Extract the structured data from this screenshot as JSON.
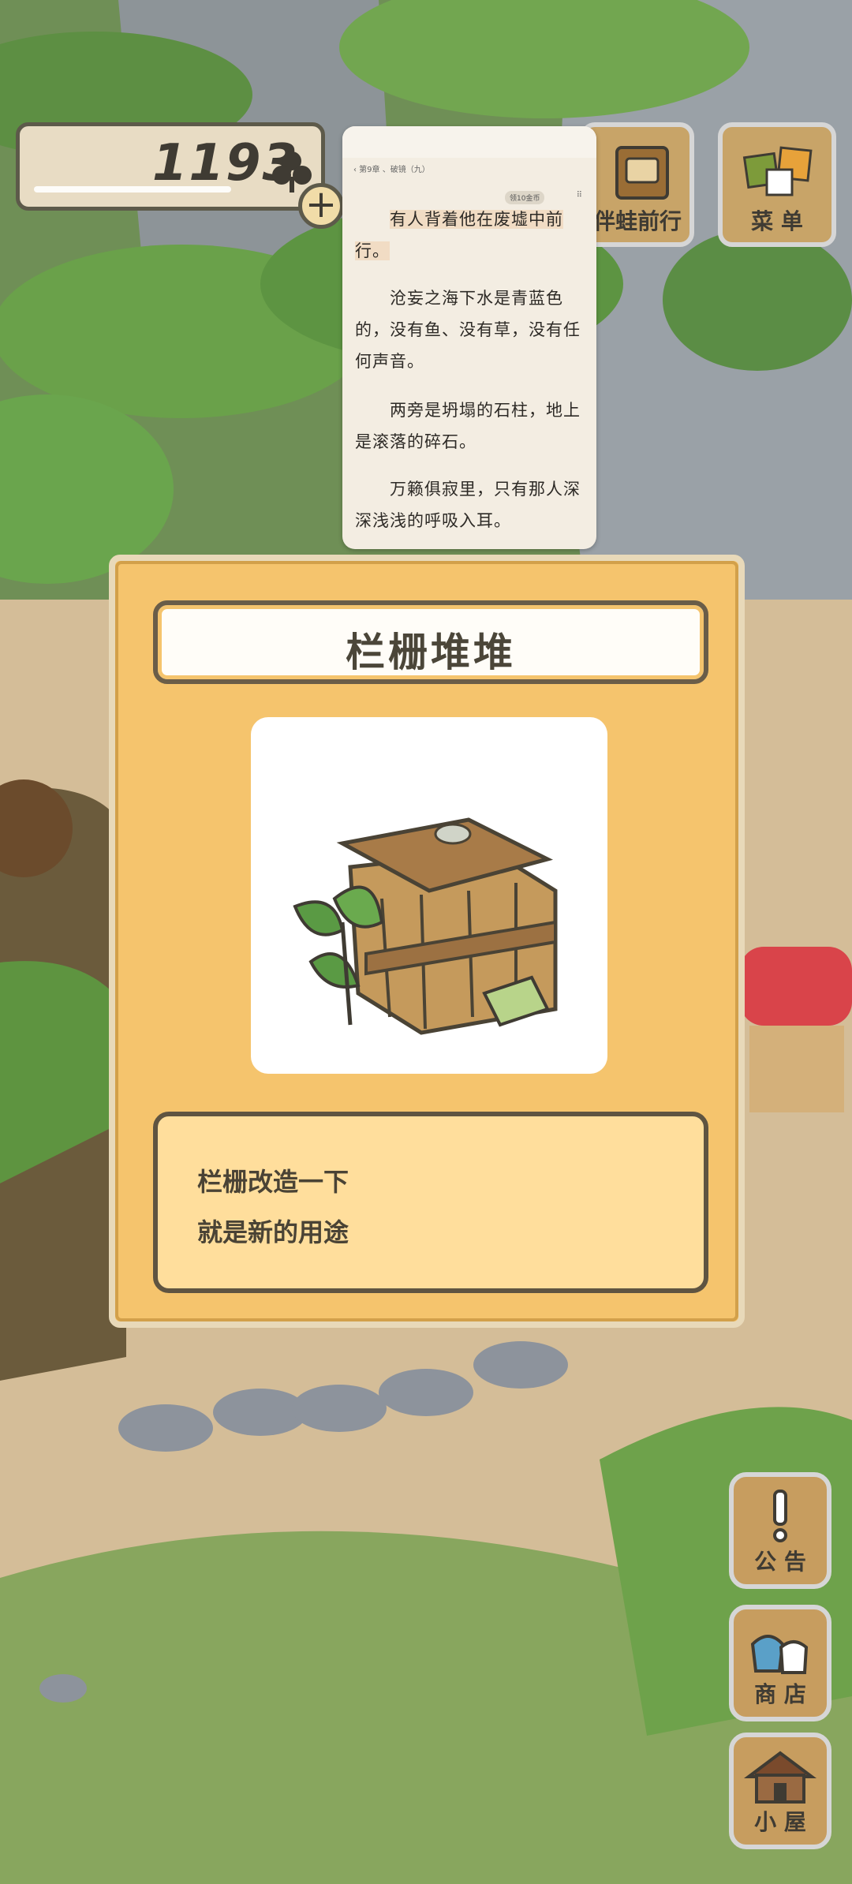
{
  "status": {
    "clover_count": "1193"
  },
  "top_buttons": {
    "frog_travel_label": "伴蛙前行",
    "menu_label": "菜 单"
  },
  "reader": {
    "breadcrumb": "‹ 第9章 、破镜（九）",
    "chip": "领10金币",
    "paragraphs": [
      "有人背着他在废墟中前行。",
      "沧妄之海下水是青蓝色的，没有鱼、没有草，没有任何声音。",
      "两旁是坍塌的石柱，地上是滚落的碎石。",
      "万籁俱寂里，只有那人深深浅浅的呼吸入耳。"
    ]
  },
  "item_card": {
    "title": "栏栅堆堆",
    "image_icon": "fence-pile-icon",
    "description_line1": "栏栅改造一下",
    "description_line2": "就是新的用途"
  },
  "side_buttons": {
    "notice_label": "公 告",
    "shop_label": "商 店",
    "house_label": "小 屋"
  }
}
